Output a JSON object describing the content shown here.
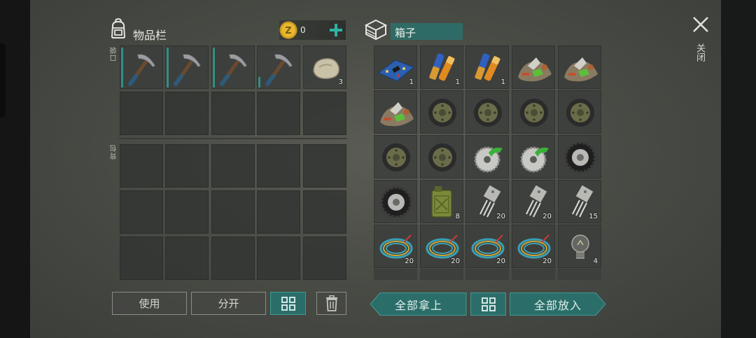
{
  "inventory": {
    "title": "物品栏",
    "coins": "0",
    "pocket_label": "口袋",
    "backpack_label": "背包",
    "pocket_row1": [
      {
        "icon": "pickaxe-icon",
        "qty": "",
        "durability": 0.95
      },
      {
        "icon": "pickaxe-icon",
        "qty": "",
        "durability": 0.95
      },
      {
        "icon": "pickaxe-icon",
        "qty": "",
        "durability": 0.95
      },
      {
        "icon": "pickaxe-icon",
        "qty": "",
        "durability": 0.25
      },
      {
        "icon": "stone-icon",
        "qty": "3"
      }
    ]
  },
  "box": {
    "title": "箱子",
    "rows": [
      [
        {
          "icon": "circuit-board-icon",
          "qty": "1"
        },
        {
          "icon": "batteries-icon",
          "qty": "1"
        },
        {
          "icon": "batteries-icon",
          "qty": "1"
        },
        {
          "icon": "scrap-pile-icon",
          "qty": ""
        },
        {
          "icon": "scrap-pile-icon",
          "qty": ""
        }
      ],
      [
        {
          "icon": "scrap-pile-icon",
          "qty": ""
        },
        {
          "icon": "wheel-icon",
          "qty": ""
        },
        {
          "icon": "wheel-icon",
          "qty": ""
        },
        {
          "icon": "wheel-icon",
          "qty": ""
        },
        {
          "icon": "wheel-icon",
          "qty": ""
        }
      ],
      [
        {
          "icon": "wheel-icon",
          "qty": ""
        },
        {
          "icon": "wheel-icon",
          "qty": ""
        },
        {
          "icon": "saw-blade-icon",
          "qty": ""
        },
        {
          "icon": "saw-blade-icon",
          "qty": ""
        },
        {
          "icon": "tire-icon",
          "qty": ""
        }
      ],
      [
        {
          "icon": "tire-icon",
          "qty": ""
        },
        {
          "icon": "jerrycan-icon",
          "qty": "8"
        },
        {
          "icon": "transistor-icon",
          "qty": "20"
        },
        {
          "icon": "transistor-icon",
          "qty": "20"
        },
        {
          "icon": "transistor-icon",
          "qty": "15"
        }
      ],
      [
        {
          "icon": "wire-coil-icon",
          "qty": "20"
        },
        {
          "icon": "wire-coil-icon",
          "qty": "20"
        },
        {
          "icon": "wire-coil-icon",
          "qty": "20"
        },
        {
          "icon": "wire-coil-icon",
          "qty": "20"
        },
        {
          "icon": "light-bulb-icon",
          "qty": "4"
        }
      ]
    ]
  },
  "buttons": {
    "use": "使用",
    "split": "分开",
    "take_all": "全部拿上",
    "put_all": "全部放入"
  },
  "close_label": "关闭",
  "colors": {
    "accent": "#2b6e69",
    "accent_bright": "#2fb3a3",
    "slot": "#3a3d3a"
  }
}
